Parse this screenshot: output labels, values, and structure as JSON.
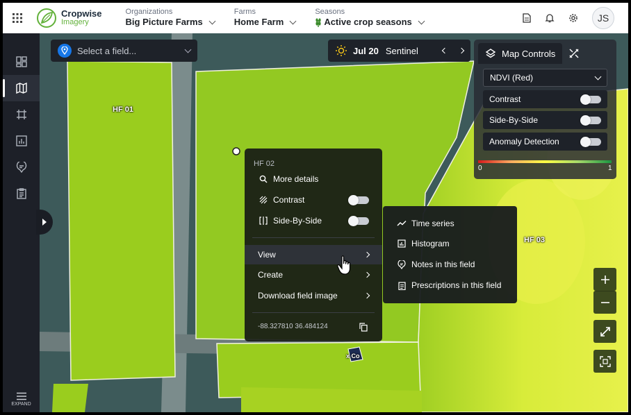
{
  "header": {
    "brand_line1": "Cropwise",
    "brand_line2": "Imagery",
    "organizations_caption": "Organizations",
    "organization": "Big Picture Farms",
    "farms_caption": "Farms",
    "farm": "Home Farm",
    "seasons_caption": "Seasons",
    "season": "Active crop seasons",
    "avatar_initials": "JS"
  },
  "sidebar": {
    "items": [
      "dashboard-icon",
      "map-icon",
      "crop-icon",
      "report-icon",
      "notes-icon",
      "prescription-icon"
    ],
    "active_index": 1,
    "expand_label": "EXPAND"
  },
  "map": {
    "field_select_placeholder": "Select a field...",
    "date": "Jul 20",
    "source": "Sentinel",
    "field_labels": [
      "HF 01",
      "HF 03"
    ],
    "small_label": "x Co"
  },
  "map_controls": {
    "tab_label": "Map Controls",
    "layer": "NDVI (Red)",
    "contrast_label": "Contrast",
    "side_by_side_label": "Side-By-Side",
    "anomaly_label": "Anomaly Detection",
    "scale_min": "0",
    "scale_max": "1"
  },
  "context_menu": {
    "title": "HF 02",
    "more_details": "More details",
    "contrast": "Contrast",
    "side_by_side": "Side-By-Side",
    "view": "View",
    "create": "Create",
    "download": "Download field image",
    "coords": "-88.327810 36.484124"
  },
  "submenu": {
    "items": [
      "Time series",
      "Histogram",
      "Notes in this field",
      "Prescriptions in this field"
    ]
  },
  "colors": {
    "field_green": "#9acd1e",
    "accent_yellow": "#e8f04a",
    "panel_dark": "#1e2229"
  }
}
